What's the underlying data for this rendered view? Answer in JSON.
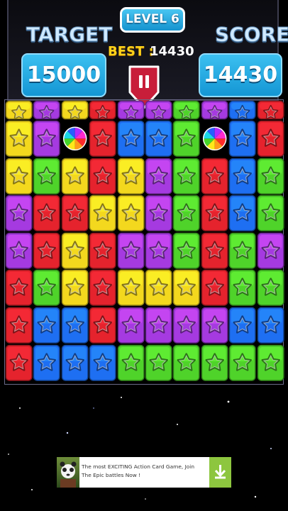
{
  "hud": {
    "level_text": "LEVEL 6",
    "target_label": "TARGET",
    "target_value": "15000",
    "score_label": "SCORE",
    "score_value": "14430",
    "best_label": "BEST :",
    "best_value": "14430"
  },
  "board": {
    "colors": {
      "Y": "#f3d81e",
      "P": "#a53ae0",
      "R": "#e5232d",
      "G": "#4fd32a",
      "B": "#1e6ff2"
    },
    "rows": [
      "YPYRPPGPBR",
      "YPWRBBGWBR",
      "YGYRYPGRBG",
      "PRRYYPGRBG",
      "PRYRPPGRGP",
      "RGYRYYYRGG",
      "RBBRPPPPBB",
      "RBBBGGGGGG"
    ],
    "row_marks": [
      "top-cut",
      "full",
      "full",
      "full",
      "full",
      "full",
      "full",
      "full"
    ],
    "special_tile": "rainbow-wildcard"
  },
  "ad": {
    "text": "The most EXCITING Action Card Game, Join The Epic battles Now !",
    "icon": "panda-warrior-avatar",
    "download_icon": "download-icon"
  }
}
